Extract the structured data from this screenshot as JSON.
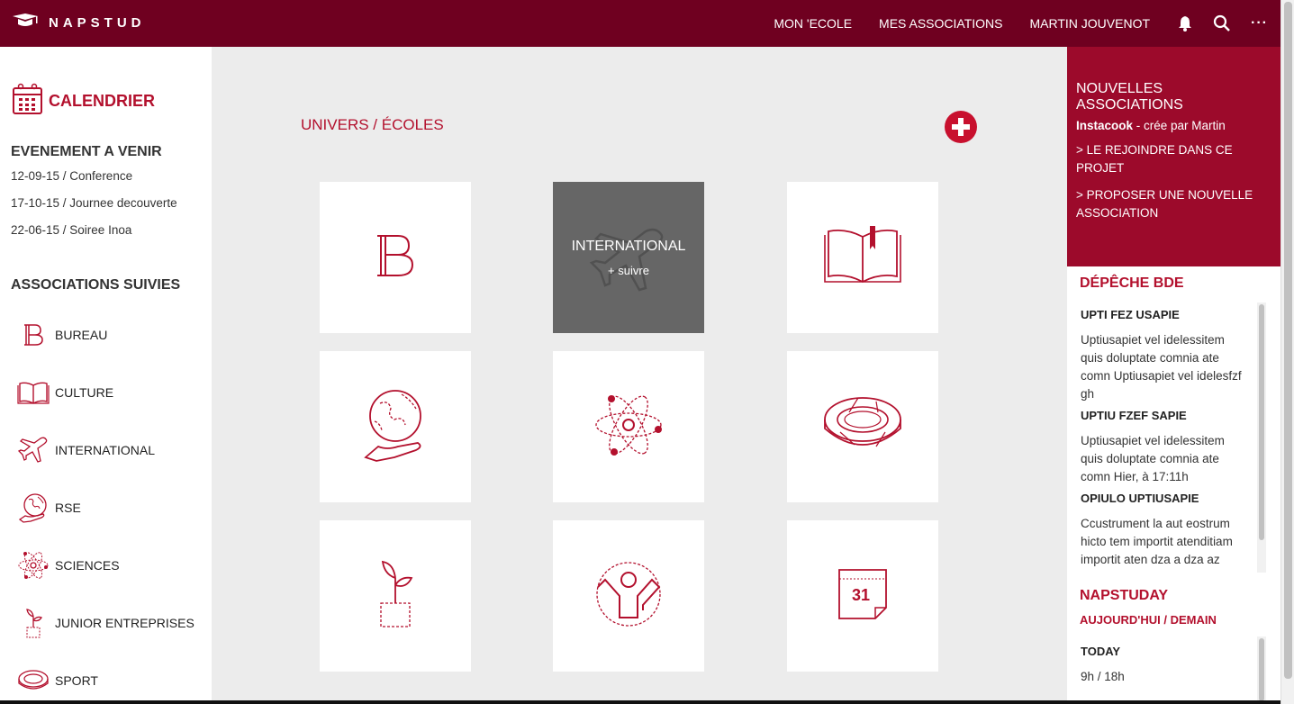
{
  "header": {
    "logo_text": "NAPSTUD",
    "nav": [
      "MON 'ECOLE",
      "MES ASSOCIATIONS",
      "MARTIN JOUVENOT"
    ]
  },
  "icons": {
    "logo": "graduation-cap-icon",
    "notifications": "bell-icon",
    "search": "search-icon",
    "more": "more-icon"
  },
  "colors": {
    "header": "#6f0020",
    "accent": "#b3102d",
    "panel": "#9c0a2b"
  },
  "sidebar": {
    "calendar_title": "CALENDRIER",
    "events_title": "EVENEMENT A VENIR",
    "events": [
      "12-09-15 / Conference",
      "17-10-15 / Journee decouverte",
      "22-06-15 / Soiree Inoa"
    ],
    "assoc_title": "ASSOCIATIONS SUIVIES",
    "assocs": [
      {
        "label": "BUREAU",
        "icon": "bureau-b-icon"
      },
      {
        "label": "CULTURE",
        "icon": "book-icon"
      },
      {
        "label": "INTERNATIONAL",
        "icon": "airplane-icon"
      },
      {
        "label": "RSE",
        "icon": "globe-hand-icon"
      },
      {
        "label": "SCIENCES",
        "icon": "atom-icon"
      },
      {
        "label": "JUNIOR ENTREPRISES",
        "icon": "plant-icon"
      },
      {
        "label": "SPORT",
        "icon": "stadium-icon"
      }
    ]
  },
  "main": {
    "breadcrumb": "UNIVERS / ÉCOLES",
    "hover_tile": {
      "title": "INTERNATIONAL",
      "follow": "+ suivre"
    }
  },
  "right": {
    "new_assoc_title": "NOUVELLES ASSOCIATIONS",
    "new_assoc_name": "Instacook",
    "new_assoc_by": " - crée par Martin",
    "link_join": "> LE REJOINDRE DANS CE PROJET",
    "link_propose": "> PROPOSER UNE NOUVELLE ASSOCIATION",
    "depeche_title": "DÉPÊCHE BDE",
    "depeches": [
      {
        "head": "UPTI FEZ USAPIE",
        "body": "Uptiusapiet vel idelessitem quis doluptate comnia ate comn Uptiusapiet vel idelesfzf gh"
      },
      {
        "head": "UPTIU FZEF SAPIE",
        "body": "Uptiusapiet vel idelessitem quis doluptate comnia ate comn Hier, à 17:11h"
      },
      {
        "head": "OPIULO UPTIUSAPIE",
        "body": "Ccustrument la aut eostrum hicto tem importit atenditiam importit aten dza a dza az"
      }
    ],
    "napstuday_title": "NAPSTUDAY",
    "napstuday_sub": "AUJOURD'HUI / DEMAIN",
    "today_label": "TODAY",
    "today_hours": "9h / 18h"
  }
}
